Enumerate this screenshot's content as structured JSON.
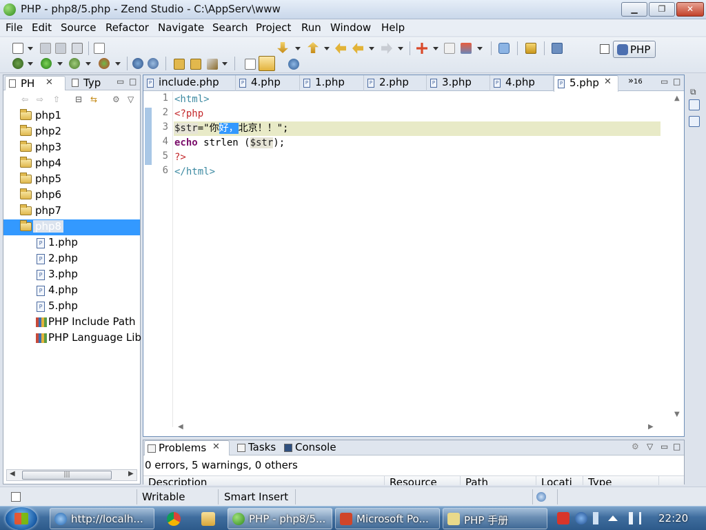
{
  "window": {
    "title": "PHP - php8/5.php - Zend Studio - C:\\AppServ\\www"
  },
  "menu": [
    "File",
    "Edit",
    "Source",
    "Refactor",
    "Navigate",
    "Search",
    "Project",
    "Run",
    "Window",
    "Help"
  ],
  "perspective": {
    "label": "PHP"
  },
  "explorer": {
    "tabs": [
      {
        "label": "PH"
      },
      {
        "label": "Typ"
      }
    ],
    "projects": [
      "php1",
      "php2",
      "php3",
      "php4",
      "php5",
      "php6",
      "php7",
      "php8"
    ],
    "selected_project": "php8",
    "php8_children": [
      "1.php",
      "2.php",
      "3.php",
      "4.php",
      "5.php"
    ],
    "libraries": [
      "PHP Include Path",
      "PHP Language Lib"
    ]
  },
  "editor": {
    "tabs": [
      "include.php",
      "4.php",
      "1.php",
      "2.php",
      "3.php",
      "4.php",
      "5.php"
    ],
    "active_tab": "5.php",
    "overflow_count": "16",
    "line_numbers": [
      "1",
      "2",
      "3",
      "4",
      "5",
      "6"
    ],
    "code": {
      "l1": "<html>",
      "l2": "<?php",
      "l3_var": "$str",
      "l3_eq": "=\"你",
      "l3_sel": "好，",
      "l3_rest": "北京！！\";",
      "l4_kw": "echo",
      "l4_fn": " strlen (",
      "l4_var": "$str",
      "l4_end": ");",
      "l5": "?>",
      "l6": "</html>"
    }
  },
  "problems": {
    "tabs": [
      "Problems",
      "Tasks",
      "Console"
    ],
    "summary": "0 errors, 5 warnings, 0 others",
    "columns": [
      "Description",
      "Resource",
      "Path",
      "Locati",
      "Type"
    ]
  },
  "status": {
    "writable": "Writable",
    "insert_mode": "Smart Insert"
  },
  "taskbar": {
    "tasks": [
      "http://localh...",
      "PHP - php8/5...",
      "Microsoft Po...",
      "PHP 手册"
    ],
    "clock": "22:20"
  }
}
